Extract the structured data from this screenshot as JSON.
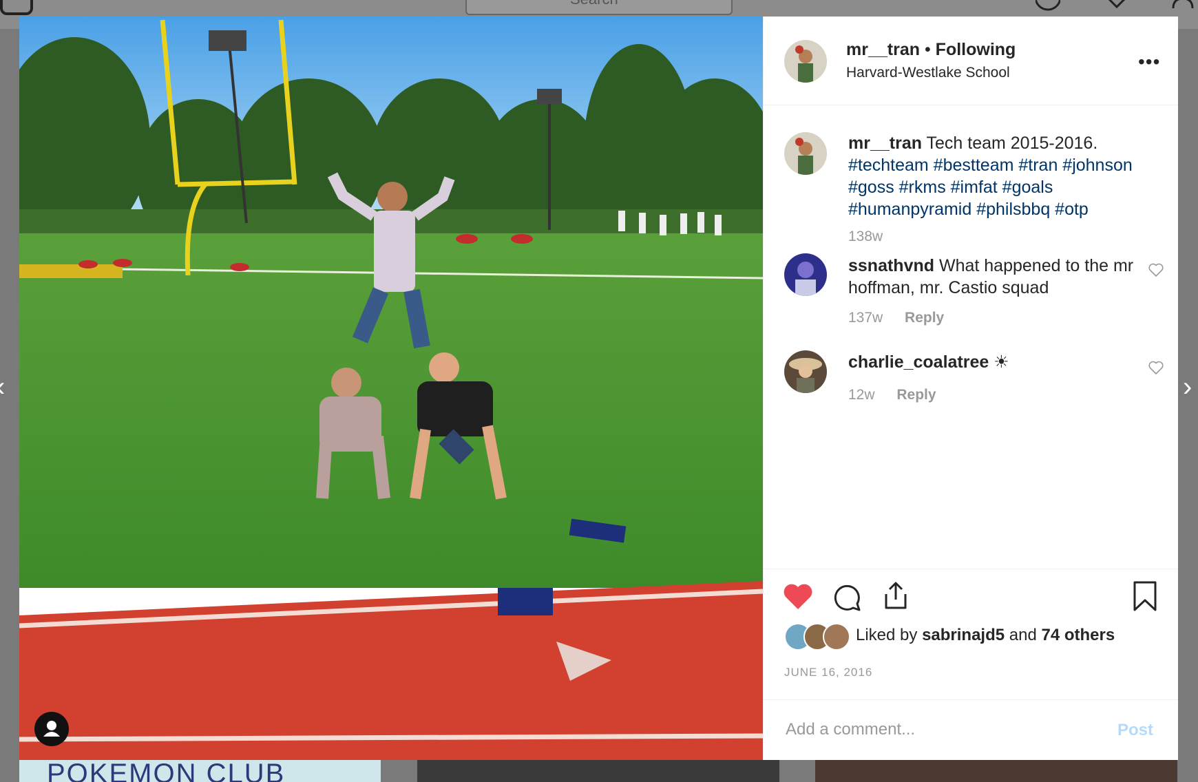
{
  "colors": {
    "link": "#003569",
    "heart": "#ed4956",
    "post_disabled": "#b3dbff",
    "muted": "#999999"
  },
  "topnav": {
    "search_placeholder": "Search"
  },
  "background_grid": {
    "thumb1_text": "POKEMON CLUB"
  },
  "post": {
    "author": "mr__tran",
    "follow_status": "Following",
    "separator": "•",
    "location": "Harvard-Westlake School",
    "more_icon": "ellipsis-icon",
    "caption": {
      "username": "mr__tran",
      "text": "Tech team 2015-2016.",
      "hashtags": "#techteam #bestteam #tran #johnson #goss #rkms #imfat #goals #humanpyramid #philsbbq #otp",
      "age": "138w"
    },
    "comments": [
      {
        "username": "ssnathvnd",
        "text": "What happened to the mr hoffman, mr. Castio squad",
        "age": "137w",
        "reply": "Reply"
      },
      {
        "username": "charlie_coalatree",
        "text": "☀",
        "age": "12w",
        "reply": "Reply"
      }
    ],
    "likes": {
      "prefix": "Liked by",
      "user": "sabrinajd5",
      "conj": "and",
      "others": "74 others"
    },
    "date": "JUNE 16, 2016",
    "add_comment_placeholder": "Add a comment...",
    "post_label": "Post"
  }
}
